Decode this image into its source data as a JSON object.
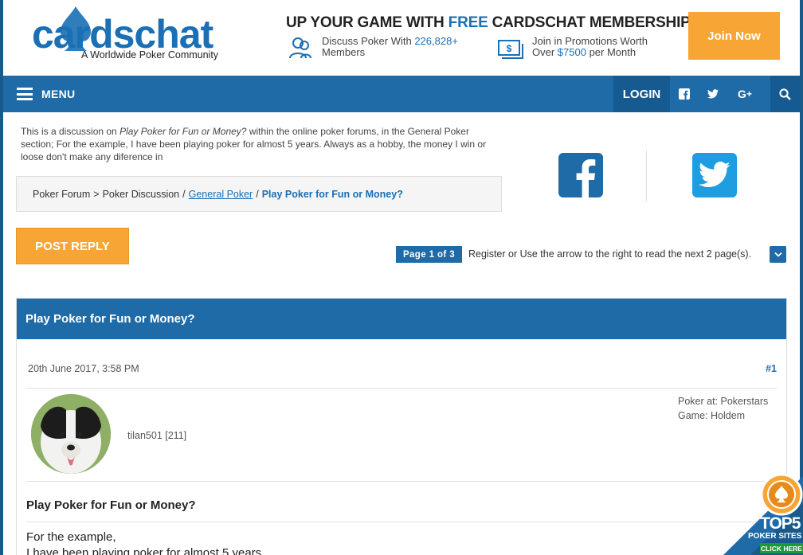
{
  "header": {
    "logo_text": "cardschat",
    "logo_tagline": "A Worldwide Poker Community",
    "promo_title_pre": "UP YOUR GAME WITH",
    "promo_title_free": "FREE",
    "promo_title_post": "CARDSCHAT MEMBERSHIP",
    "promo1_pre": "Discuss Poker With",
    "promo1_count": "226,828+",
    "promo1_post": "Members",
    "promo2_pre": "Join in Promotions Worth",
    "promo2_over": "Over",
    "promo2_amount": "$7500",
    "promo2_post": "per Month",
    "join_label": "Join Now"
  },
  "nav": {
    "menu_label": "MENU",
    "login_label": "LOGIN"
  },
  "intro": {
    "pre": "This is a discussion on",
    "topic": "Play Poker for Fun or Money?",
    "post": "within the online poker forums, in the General Poker section; For the example, I have been playing poker for almost 5 years. Always as a hobby, the money I win or loose don't make any diference in"
  },
  "breadcrumb": {
    "forum": "Poker Forum",
    "sep1": ">",
    "discussion": "Poker Discussion",
    "sep2": "/",
    "general": "General Poker",
    "sep3": "/",
    "current": "Play Poker for Fun or Money?"
  },
  "actions": {
    "post_reply": "POST REPLY",
    "page_badge": "Page 1 of 3",
    "page_note": "Register or Use the arrow to the right to read the next 2 page(s)."
  },
  "thread": {
    "title": "Play Poker for Fun or Money?",
    "post": {
      "date": "20th June 2017, 3:58 PM",
      "number": "#1",
      "username": "tilan501 [211]",
      "poker_at": "Poker at: Pokerstars",
      "game": "Game: Holdem",
      "title": "Play Poker for Fun or Money?",
      "line1": "For the example,",
      "line2": "I have been playing poker for almost 5 years"
    }
  },
  "badge": {
    "top5": "TOP5",
    "sites": "POKER SITES",
    "click": "CLICK HERE"
  },
  "colors": {
    "brand_blue": "#1e6ba8",
    "accent_orange": "#f7a535",
    "twitter_blue": "#1e9de0"
  }
}
